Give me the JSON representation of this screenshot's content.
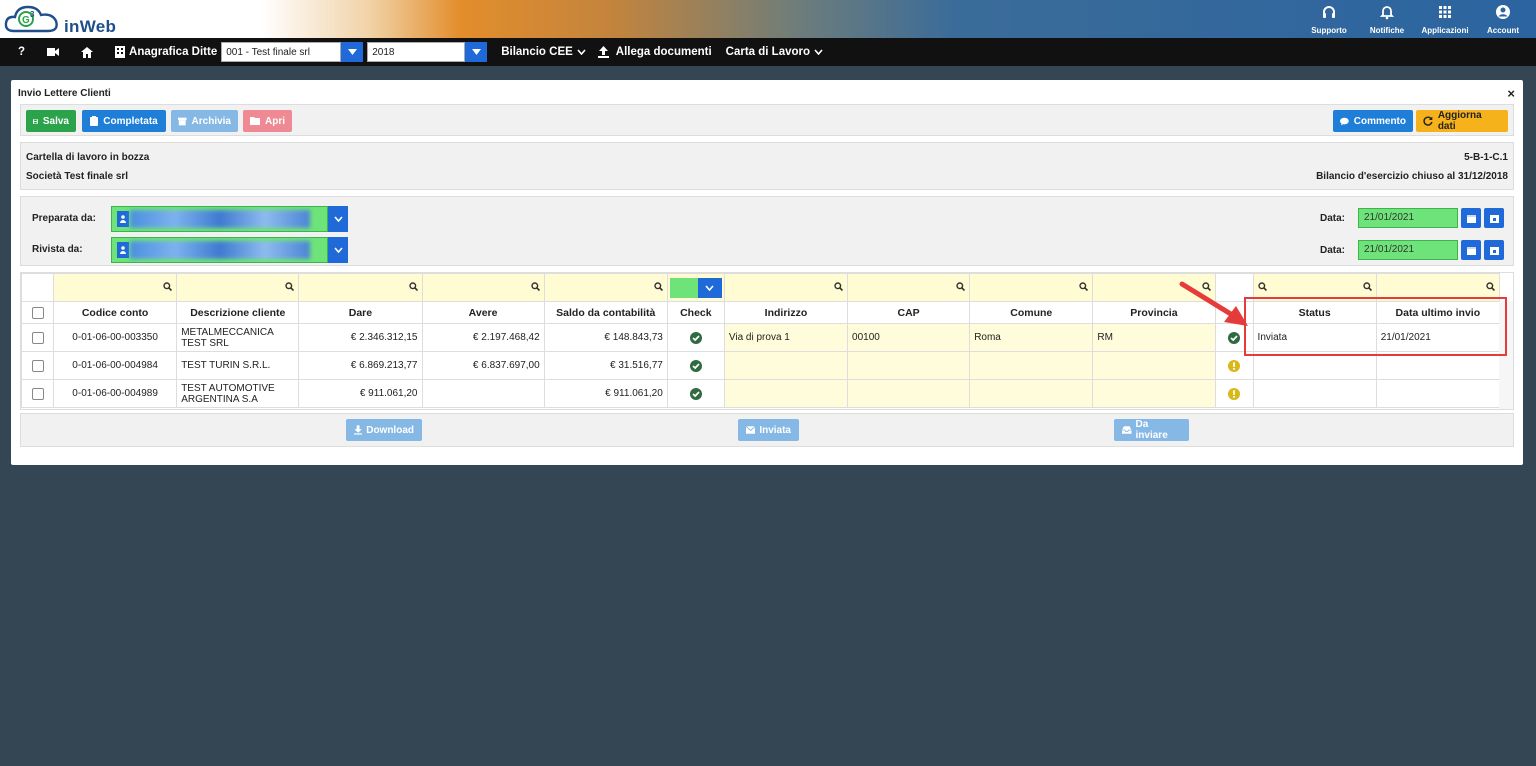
{
  "app": {
    "brand_text": "inWeb"
  },
  "top_actions": [
    {
      "label": "Supporto",
      "icon": "headset-icon"
    },
    {
      "label": "Notifiche",
      "icon": "bell-icon"
    },
    {
      "label": "Applicazioni",
      "icon": "grid-icon"
    },
    {
      "label": "Account",
      "icon": "account-icon"
    }
  ],
  "nav": {
    "help": "?",
    "company_label": "Anagrafica Ditte",
    "company_value": "001 - Test finale srl",
    "year_value": "2018",
    "bilancio": "Bilancio CEE",
    "allega": "Allega documenti",
    "carta": "Carta di Lavoro"
  },
  "panel": {
    "title": "Invio Lettere Clienti",
    "close": "×",
    "buttons": {
      "salva": "Salva",
      "completata": "Completata",
      "archivia": "Archivia",
      "apri": "Apri",
      "commento": "Commento",
      "aggiorna": "Aggiorna dati"
    },
    "info": {
      "status": "Cartella di lavoro in bozza",
      "company": "Società Test finale srl",
      "code": "5-B-1-C.1",
      "period": "Bilancio d'esercizio chiuso al 31/12/2018"
    },
    "people": {
      "prepared_label": "Preparata da:",
      "reviewed_label": "Rivista da:",
      "date_label": "Data:",
      "prepared_date": "21/01/2021",
      "reviewed_date": "21/01/2021"
    }
  },
  "table": {
    "columns": [
      "Codice conto",
      "Descrizione cliente",
      "Dare",
      "Avere",
      "Saldo da contabilità",
      "Check",
      "Indirizzo",
      "CAP",
      "Comune",
      "Provincia",
      "",
      "Status",
      "Data ultimo invio"
    ],
    "rows": [
      {
        "codice": "0-01-06-00-003350",
        "descrizione": "METALMECCANICA TEST SRL",
        "dare": "€ 2.346.312,15",
        "avere": "€ 2.197.468,42",
        "saldo": "€ 148.843,73",
        "indirizzo": "Via di prova 1",
        "cap": "00100",
        "comune": "Roma",
        "provincia": "RM",
        "status": "Inviata",
        "data_invio": "21/01/2021",
        "state": "ok"
      },
      {
        "codice": "0-01-06-00-004984",
        "descrizione": "TEST TURIN S.R.L.",
        "dare": "€ 6.869.213,77",
        "avere": "€ 6.837.697,00",
        "saldo": "€ 31.516,77",
        "indirizzo": "",
        "cap": "",
        "comune": "",
        "provincia": "",
        "status": "",
        "data_invio": "",
        "state": "warn"
      },
      {
        "codice": "0-01-06-00-004989",
        "descrizione": "TEST AUTOMOTIVE ARGENTINA S.A",
        "dare": "€ 911.061,20",
        "avere": "",
        "saldo": "€ 911.061,20",
        "indirizzo": "",
        "cap": "",
        "comune": "",
        "provincia": "",
        "status": "",
        "data_invio": "",
        "state": "warn"
      }
    ]
  },
  "footer_buttons": {
    "download": "Download",
    "inviata": "Inviata",
    "da_inviare": "Da inviare"
  },
  "colors": {
    "accent_blue": "#1f6ad8",
    "ok_green": "#2aa34a",
    "warn_yellow": "#e6c21a",
    "highlight": "#e53b3b"
  }
}
